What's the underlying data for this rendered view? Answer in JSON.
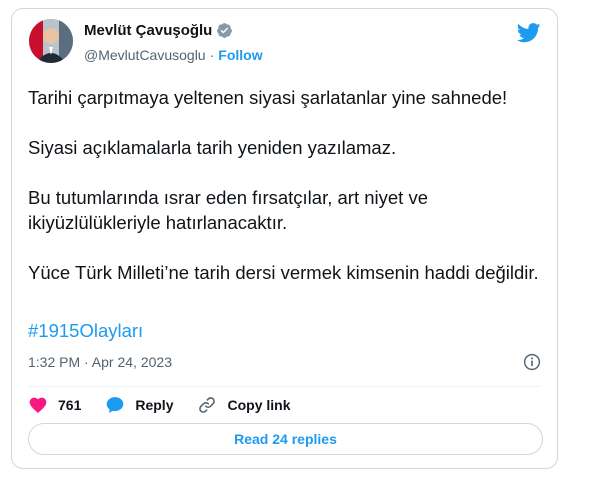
{
  "author": {
    "name": "Mevlüt Çavuşoğlu",
    "handle": "@MevlutCavusoglu",
    "separator": "·",
    "follow_label": "Follow"
  },
  "tweet": {
    "paragraphs": [
      "Tarihi çarpıtmaya yeltenen siyasi şarlatanlar yine sahnede!",
      "Siyasi açıklamalarla tarih yeniden yazılamaz.",
      "Bu tutumlarında ısrar eden fırsatçılar, art niyet ve ikiyüzlülükleriyle hatırlanacaktır.",
      "Yüce Türk Milleti’ne tarih dersi vermek kimsenin haddi değildir."
    ],
    "hashtag": "#1915Olayları",
    "timestamp": "1:32 PM · Apr 24, 2023"
  },
  "actions": {
    "like_count": "761",
    "reply_label": "Reply",
    "copy_link_label": "Copy link"
  },
  "read_replies_label": "Read 24 replies",
  "colors": {
    "accent": "#1d9bf0",
    "like": "#f91880",
    "muted": "#536471",
    "border": "#cfd9de"
  },
  "icons": [
    "verified-badge-icon",
    "twitter-bird-icon",
    "info-icon",
    "heart-icon",
    "reply-bubble-icon",
    "link-icon"
  ]
}
